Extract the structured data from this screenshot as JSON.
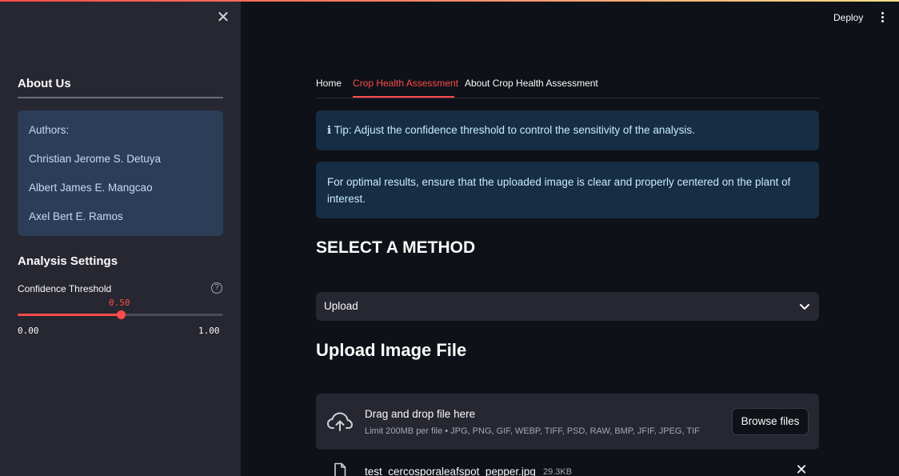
{
  "header": {
    "deploy_label": "Deploy",
    "menu_icon": "more-vertical-icon",
    "accent_color": "#ff4b4b"
  },
  "sidebar": {
    "close_icon": "close-icon",
    "close_glyph": "✕",
    "about_title": "About Us",
    "authors": [
      "Authors:",
      "Christian Jerome S. Detuya",
      "Albert James E. Mangcao",
      "Axel Bert E. Ramos"
    ],
    "settings_title": "Analysis Settings",
    "slider": {
      "label": "Confidence Threshold",
      "help_glyph": "?",
      "value": 0.5,
      "value_label": "0.50",
      "min_label": "0.00",
      "max_label": "1.00"
    }
  },
  "main": {
    "tabs": [
      {
        "label": "Home",
        "active": false
      },
      {
        "label": "Crop Health Assessment",
        "active": true
      },
      {
        "label": "About Crop Health Assessment",
        "active": false
      }
    ],
    "tip": "ℹ Tip: Adjust the confidence threshold to control the sensitivity of the analysis.",
    "advice": "For optimal results, ensure that the uploaded image is clear and properly centered on the plant of interest.",
    "method_heading": "SELECT A METHOD",
    "method_select": {
      "value": "Upload"
    },
    "upload_heading": "Upload Image File",
    "dropzone": {
      "icon": "cloud-upload-icon",
      "title": "Drag and drop file here",
      "limit": "Limit 200MB per file • JPG, PNG, GIF, WEBP, TIFF, PSD, RAW, BMP, JFIF, JPEG, TIF",
      "browse_label": "Browse files"
    },
    "file": {
      "icon": "file-icon",
      "name": "test_cercosporaleafspot_pepper.jpg",
      "size": "29.3KB",
      "remove_glyph": "✕"
    }
  }
}
